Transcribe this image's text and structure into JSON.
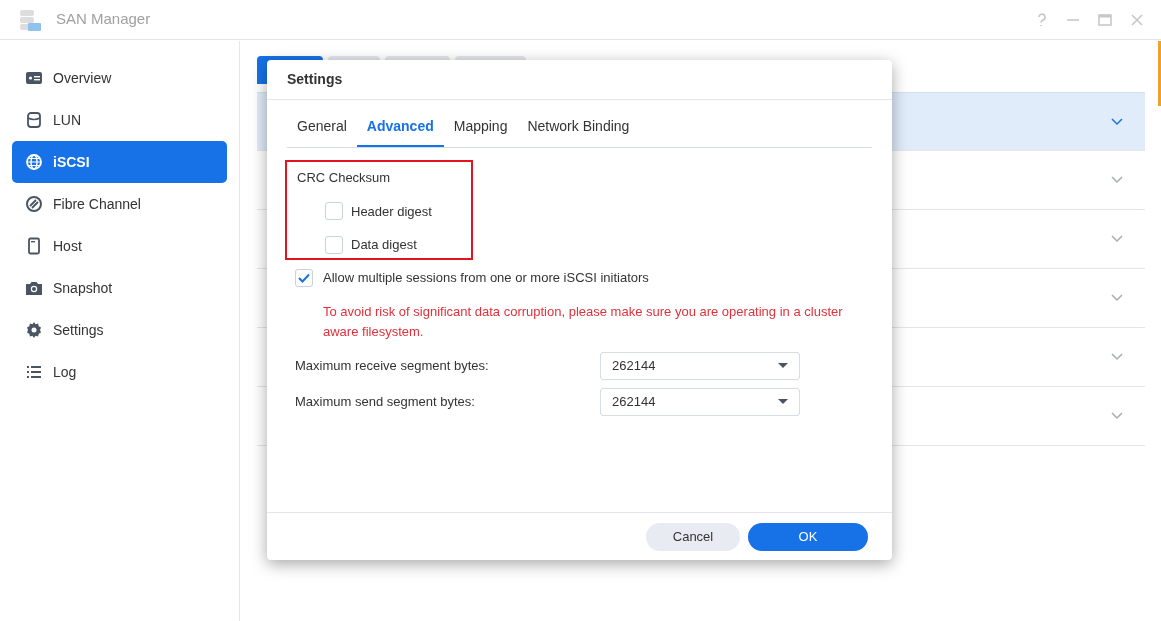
{
  "window": {
    "title": "SAN Manager"
  },
  "sidebar": {
    "items": [
      {
        "label": "Overview",
        "selected": false
      },
      {
        "label": "LUN",
        "selected": false
      },
      {
        "label": "iSCSI",
        "selected": true
      },
      {
        "label": "Fibre Channel",
        "selected": false
      },
      {
        "label": "Host",
        "selected": false
      },
      {
        "label": "Snapshot",
        "selected": false
      },
      {
        "label": "Settings",
        "selected": false
      },
      {
        "label": "Log",
        "selected": false
      }
    ]
  },
  "background": {
    "tabs": [
      {
        "selected": true
      },
      {
        "selected": false
      },
      {
        "selected": false
      },
      {
        "selected": false
      }
    ],
    "rows": [
      {
        "selected": true
      },
      {
        "selected": false
      },
      {
        "selected": false
      },
      {
        "selected": false
      },
      {
        "selected": false
      },
      {
        "selected": false
      }
    ]
  },
  "dialog": {
    "title": "Settings",
    "tabs": [
      {
        "label": "General",
        "selected": false
      },
      {
        "label": "Advanced",
        "selected": true
      },
      {
        "label": "Mapping",
        "selected": false
      },
      {
        "label": "Network Binding",
        "selected": false
      }
    ],
    "crc_group": {
      "label": "CRC Checksum",
      "highlighted": true,
      "options": [
        {
          "label": "Header digest",
          "checked": false
        },
        {
          "label": "Data digest",
          "checked": false
        }
      ]
    },
    "multiple_sessions": {
      "label": "Allow multiple sessions from one or more iSCSI initiators",
      "checked": true
    },
    "warning": "To avoid risk of significant data corruption, please make sure you are operating in a cluster aware filesystem.",
    "fields": [
      {
        "label": "Maximum receive segment bytes:",
        "value": "262144"
      },
      {
        "label": "Maximum send segment bytes:",
        "value": "262144"
      }
    ],
    "buttons": [
      {
        "label": "Cancel",
        "kind": "secondary"
      },
      {
        "label": "OK",
        "kind": "primary"
      }
    ]
  }
}
